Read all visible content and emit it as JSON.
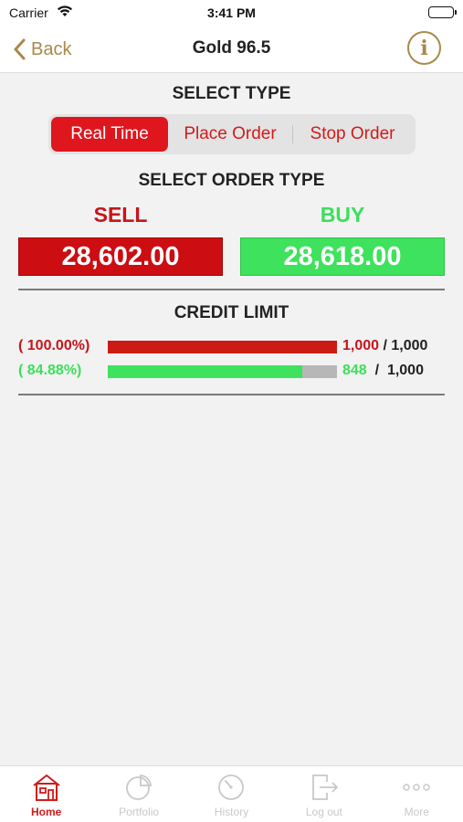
{
  "status_bar": {
    "carrier": "Carrier",
    "time": "3:41 PM"
  },
  "nav": {
    "back_label": "Back",
    "title": "Gold 96.5",
    "info_icon": "info-icon"
  },
  "select_type": {
    "title": "SELECT TYPE",
    "options": [
      "Real Time",
      "Place Order",
      "Stop Order"
    ],
    "selected": "Real Time"
  },
  "order_type": {
    "title": "SELECT ORDER TYPE",
    "sell": {
      "label": "SELL",
      "price": "28,602.00"
    },
    "buy": {
      "label": "BUY",
      "price": "28,618.00"
    }
  },
  "credit_limit": {
    "title": "CREDIT LIMIT",
    "rows": [
      {
        "percent": "( 100.00%)",
        "used": "1,000",
        "total": "1,000",
        "fill": 1.0,
        "color": "#cc1a14"
      },
      {
        "percent": "( 84.88%)",
        "used": "848",
        "total": "1,000",
        "fill": 0.8488,
        "color": "#3ee25c"
      }
    ]
  },
  "tabs": [
    {
      "label": "Home",
      "icon": "home-icon",
      "active": true
    },
    {
      "label": "Portfolio",
      "icon": "pie-chart-icon",
      "active": false
    },
    {
      "label": "History",
      "icon": "clock-icon",
      "active": false
    },
    {
      "label": "Log out",
      "icon": "logout-icon",
      "active": false
    },
    {
      "label": "More",
      "icon": "more-icon",
      "active": false
    }
  ],
  "colors": {
    "accent_gold": "#a8894a",
    "sell_red": "#cc0d12",
    "buy_green": "#3ee25c",
    "active_tab": "#d11b1b"
  }
}
